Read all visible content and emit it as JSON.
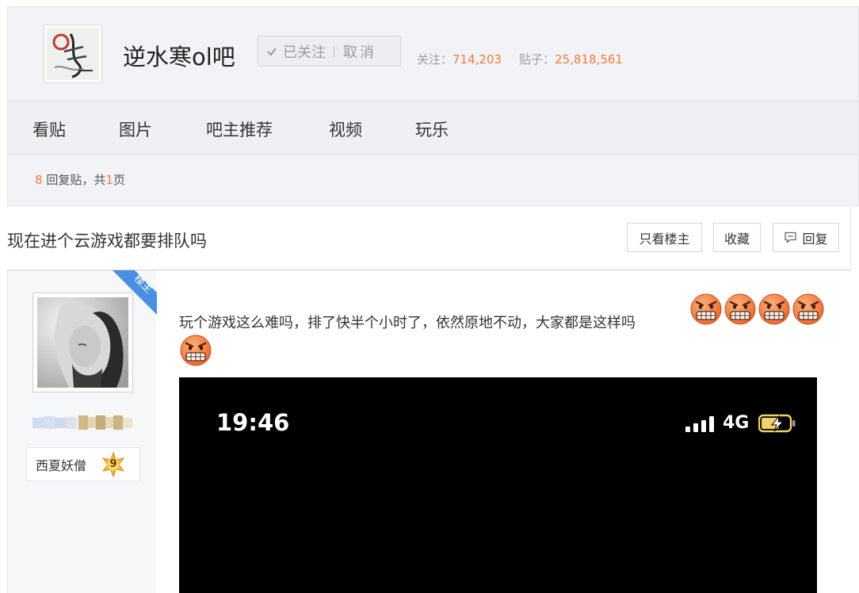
{
  "forum": {
    "name": "逆水寒ol吧",
    "follow_label": "已关注",
    "unfollow_label": "取消",
    "follow_stat_label": "关注：",
    "follow_stat_value": "714,203",
    "post_stat_label": "贴子：",
    "post_stat_value": "25,818,561",
    "accent_color": "#f17a3c"
  },
  "nav": {
    "items": [
      "看贴",
      "图片",
      "吧主推荐",
      "视频",
      "玩乐"
    ]
  },
  "reply_summary": {
    "count": "8",
    "middle_text": " 回复贴，共",
    "pages": "1",
    "suffix": "页"
  },
  "thread": {
    "title": "现在进个云游戏都要排队吗",
    "only_op_label": "只看楼主",
    "favorite_label": "收藏",
    "reply_label": "回复"
  },
  "post": {
    "op_badge": "楼主",
    "author_level_title": "西夏妖僧",
    "author_level": "9",
    "text": "玩个游戏这么难吗，排了快半个小时了，依然原地不动，大家都是这样吗",
    "emoji_icon": "angry-grin-emoji",
    "emoji_count": 5,
    "screenshot": {
      "time": "19:46",
      "network": "4G"
    }
  }
}
